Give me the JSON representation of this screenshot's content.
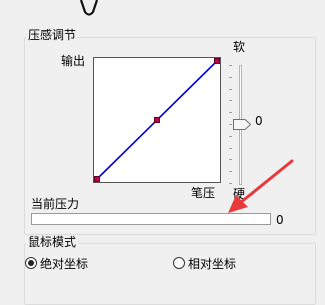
{
  "pressure_group": {
    "title": "压感调节",
    "output_label": "输出",
    "pen_pressure_label": "笔压",
    "curve_points": [
      {
        "input": 0.0,
        "output": 0.0
      },
      {
        "input": 0.5,
        "output": 0.5
      },
      {
        "input": 1.0,
        "output": 1.0
      }
    ],
    "softness": {
      "soft_label": "软",
      "hard_label": "硬",
      "value": "0",
      "level": 0.5
    },
    "current_pressure": {
      "label": "当前压力",
      "value": "0",
      "level": 0
    }
  },
  "mouse_group": {
    "title": "鼠标模式",
    "options": [
      {
        "label": "绝对坐标",
        "selected": true
      },
      {
        "label": "相对坐标",
        "selected": false
      }
    ]
  },
  "colors": {
    "curve_line": "#0000d8",
    "curve_point": "#c4004a",
    "annotation_arrow": "#e83a3a"
  }
}
